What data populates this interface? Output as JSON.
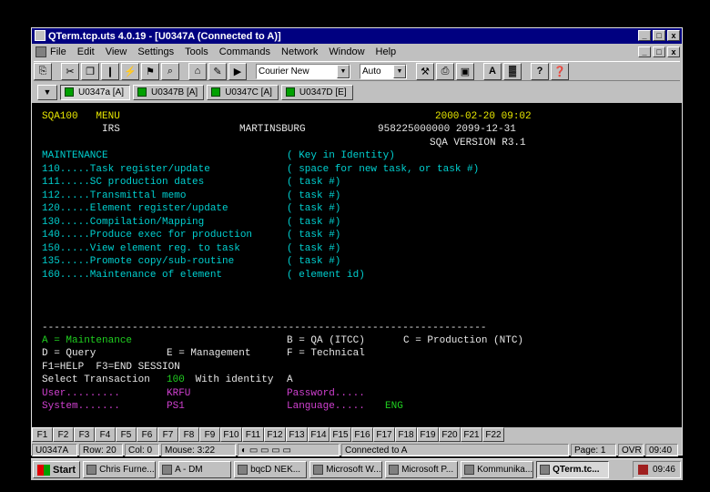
{
  "window": {
    "title": "QTerm.tcp.uts 4.0.19 - [U0347A (Connected to A)]",
    "controls": [
      "_",
      "□",
      "x"
    ],
    "mdi_controls": [
      "_",
      "□",
      "x"
    ]
  },
  "menu": [
    "File",
    "Edit",
    "View",
    "Settings",
    "Tools",
    "Commands",
    "Network",
    "Window",
    "Help"
  ],
  "toolbar": {
    "font_value": "Courier New",
    "size_value": "Auto",
    "buttons_left": [
      "⎘",
      "✂",
      "❐",
      "❙",
      "⚡",
      "⚑",
      "⌕",
      "⌂",
      "✎",
      "▶"
    ],
    "buttons_right": [
      "⚒",
      "⎙",
      "▣",
      "A",
      "▓",
      "?",
      "❓"
    ]
  },
  "sessions": {
    "nav_arrow": "▼",
    "tabs": [
      "U0347a [A]",
      "U0347B [A]",
      "U0347C [A]",
      "U0347D [E]"
    ]
  },
  "screen": {
    "line1": {
      "left": "SQA100   MENU",
      "right": "2000-02-20 09:02"
    },
    "line2": {
      "a": "IRS",
      "b": "MARTINSBURG",
      "c": "958225000000 2099-12-31"
    },
    "line3": "SQA VERSION R3.1",
    "section": {
      "title": "MAINTENANCE",
      "hint": "( Key in Identity)"
    },
    "menu_items": [
      {
        "code": "110.....Task register/update",
        "hint": "( space for new task, or task #)"
      },
      {
        "code": "111.....SC production dates",
        "hint": "( task #)"
      },
      {
        "code": "112.....Transmittal memo",
        "hint": "( task #)"
      },
      {
        "code": "120.....Element register/update",
        "hint": "( task #)"
      },
      {
        "code": "130.....Compilation/Mapping",
        "hint": "( task #)"
      },
      {
        "code": "140.....Produce exec for production",
        "hint": "( task #)"
      },
      {
        "code": "150.....View element reg. to task",
        "hint": "( task #)"
      },
      {
        "code": "135.....Promote copy/sub-routine",
        "hint": "( task #)"
      },
      {
        "code": "160.....Maintenance of element",
        "hint": "( element id)"
      }
    ],
    "separator": "--------------------------------------------------------------------------",
    "legend1": {
      "a": "A = Maintenance",
      "b": "B = QA (ITCC)",
      "c": "C = Production (NTC)"
    },
    "legend2": {
      "a": "D = Query",
      "b": "E = Management",
      "c": "F = Technical"
    },
    "help_line": "F1=HELP  F3=END SESSION",
    "select": {
      "pre": "Select Transaction ",
      "num": "100",
      "post": " With identity ",
      "id": "A"
    },
    "user": {
      "label": "User.........",
      "value": "KRFU",
      "pw_label": "Password....."
    },
    "system": {
      "label": "System.......",
      "value": "PS1",
      "lang_label": "Language.....",
      "lang_value": "ENG"
    }
  },
  "fkeys": [
    "F1",
    "F2",
    "F3",
    "F4",
    "F5",
    "F6",
    "F7",
    "F8",
    "F9",
    "F10",
    "F11",
    "F12",
    "F13",
    "F14",
    "F15",
    "F16",
    "F17",
    "F18",
    "F19",
    "F20",
    "F21",
    "F22"
  ],
  "status": {
    "session": "U0347A",
    "row": "Row: 20",
    "col": "Col: 0",
    "mouse": "Mouse:  3:22",
    "conn": "Connected to A",
    "page": "Page: 1",
    "ovr": "OVR",
    "time": "09:40"
  },
  "taskbar": {
    "start": "Start",
    "items": [
      "Chris Furne...",
      "A - DM",
      "bqcD NEK...",
      "Microsoft W...",
      "Microsoft P...",
      "Kommunika...",
      "QTerm.tc..."
    ],
    "clock": "09:46"
  }
}
